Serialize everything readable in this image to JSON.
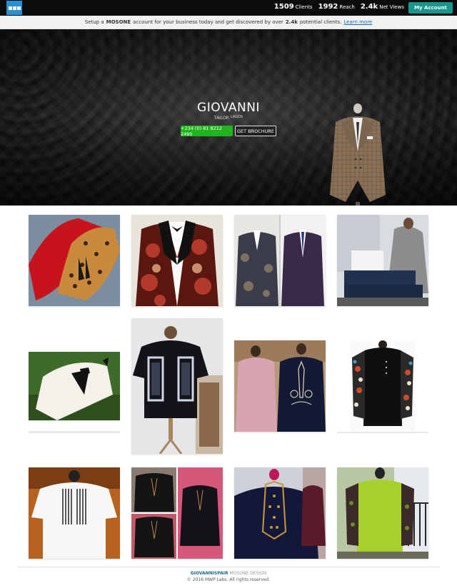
{
  "topbar": {
    "logo_icon": "brand-logo-icon",
    "stats": [
      {
        "value": "1509",
        "label": "Clients"
      },
      {
        "value": "1992",
        "label": "Reach"
      },
      {
        "value": "2.4k",
        "label": "Net Views"
      }
    ],
    "account_button": "My Account",
    "accent_color": "#16968c"
  },
  "notice": {
    "text_before": "Setup a",
    "brand": "MOSONE",
    "text_middle": "account for your business today and get discovered by over",
    "count": "2.4k",
    "text_after": "potential clients.",
    "link": "Learn more"
  },
  "hero": {
    "title": "GIOVANNI",
    "role": "TAILOR",
    "city": "LAGOS",
    "phone_button": "+234 (0) 81 8212 2490",
    "brochure_button": "GET BROCHURE",
    "phone_color": "#1fb51f"
  },
  "gallery": [
    {
      "name": "leopard-loafers-photo",
      "icon": "shoe-image"
    },
    {
      "name": "floral-tuxedo-photo",
      "icon": "jacket-image"
    },
    {
      "name": "two-suits-photo",
      "icon": "suit-image"
    },
    {
      "name": "tailor-workshop-photo",
      "icon": "sewing-image"
    },
    {
      "name": "white-tuxedo-photo",
      "icon": "tuxedo-image"
    },
    {
      "name": "black-panel-shirt-photo",
      "icon": "shirt-image"
    },
    {
      "name": "embroidered-kaftans-photo",
      "icon": "kaftan-image"
    },
    {
      "name": "patterned-sleeve-kaftan-photo",
      "icon": "kaftan-image"
    },
    {
      "name": "striped-white-shirt-photo",
      "icon": "shirt-image"
    },
    {
      "name": "black-shirts-collage-photo",
      "icon": "shirt-image"
    },
    {
      "name": "embroidered-agbada-photo",
      "icon": "agbada-image"
    },
    {
      "name": "green-kaftan-photo",
      "icon": "kaftan-image"
    }
  ],
  "footer": {
    "brand": "GIOVANNISPAIR",
    "suffix": "MOSONE DESIGN",
    "copyright": "© 2016 MWP Labs. All rights reserved."
  }
}
